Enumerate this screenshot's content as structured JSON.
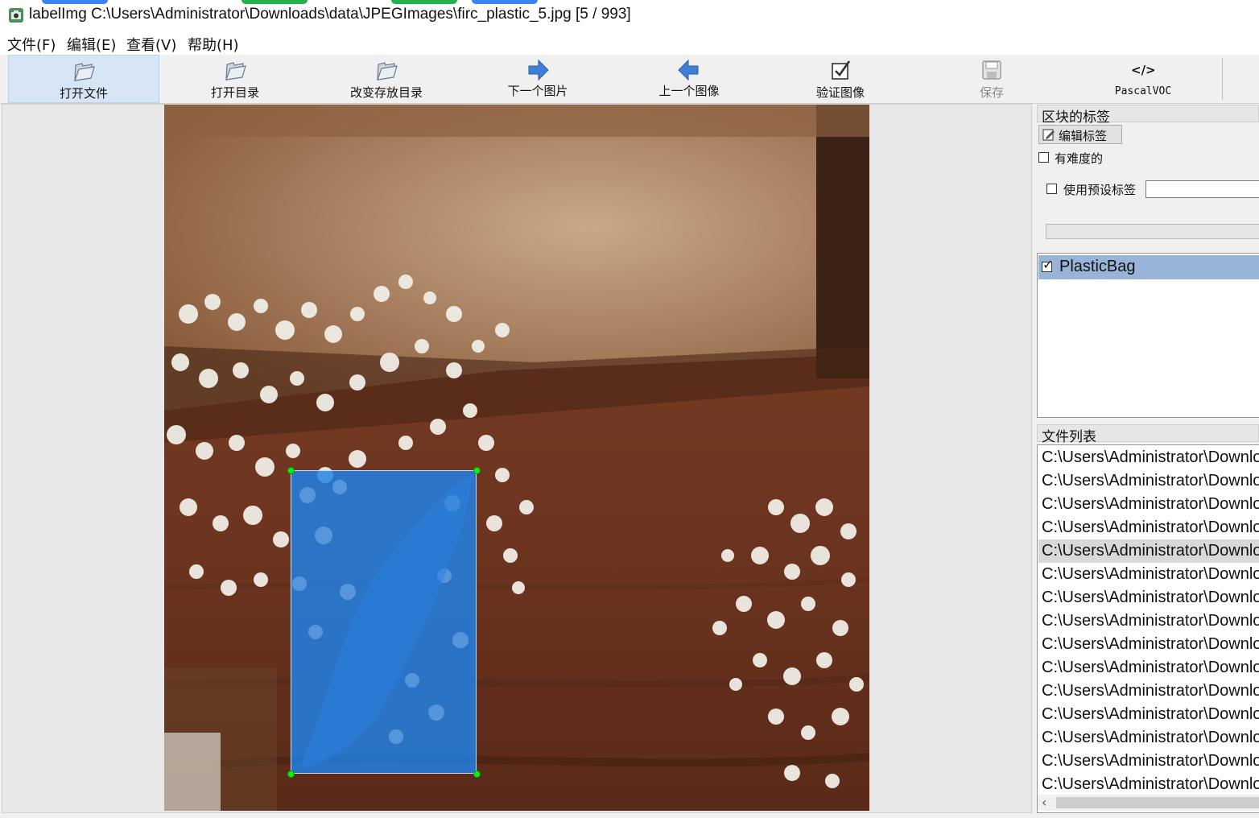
{
  "window": {
    "title": "labelImg C:\\Users\\Administrator\\Downloads\\data\\JPEGImages\\firc_plastic_5.jpg [5 / 993]"
  },
  "menu": [
    {
      "label": "文件(F)"
    },
    {
      "label": "编辑(E)"
    },
    {
      "label": "查看(V)"
    },
    {
      "label": "帮助(H)"
    }
  ],
  "toolbar": [
    {
      "label": "打开文件",
      "icon": "folder-open-icon"
    },
    {
      "label": "打开目录",
      "icon": "folder-open-icon"
    },
    {
      "label": "改变存放目录",
      "icon": "folder-open-icon"
    },
    {
      "label": "下一个图片",
      "icon": "arrow-right-icon"
    },
    {
      "label": "上一个图像",
      "icon": "arrow-left-icon"
    },
    {
      "label": "验证图像",
      "icon": "checkbox-icon"
    },
    {
      "label": "保存",
      "icon": "save-icon"
    },
    {
      "label": "PascalVOC",
      "icon": "code-icon",
      "icon_text": "</>"
    }
  ],
  "right_panel": {
    "box_labels_title": "区块的标签",
    "edit_label_button": "编辑标签",
    "difficult_label": "有难度的",
    "use_default_label": "使用预设标签",
    "labels": [
      {
        "name": "PlasticBag",
        "checked": true
      }
    ],
    "file_list_title": "文件列表",
    "files": [
      "C:\\Users\\Administrator\\Downloads",
      "C:\\Users\\Administrator\\Downloads",
      "C:\\Users\\Administrator\\Downloads",
      "C:\\Users\\Administrator\\Downloads",
      "C:\\Users\\Administrator\\Downloads",
      "C:\\Users\\Administrator\\Downloads",
      "C:\\Users\\Administrator\\Downloads",
      "C:\\Users\\Administrator\\Downloads",
      "C:\\Users\\Administrator\\Downloads",
      "C:\\Users\\Administrator\\Downloads",
      "C:\\Users\\Administrator\\Downloads",
      "C:\\Users\\Administrator\\Downloads",
      "C:\\Users\\Administrator\\Downloads",
      "C:\\Users\\Administrator\\Downloads",
      "C:\\Users\\Administrator\\Downloads"
    ],
    "selected_file_index": 4
  },
  "colors": {
    "bbox_fill": "#1e82eb",
    "bbox_handle": "#19e619",
    "selected_label_bg": "#99b4d9"
  }
}
